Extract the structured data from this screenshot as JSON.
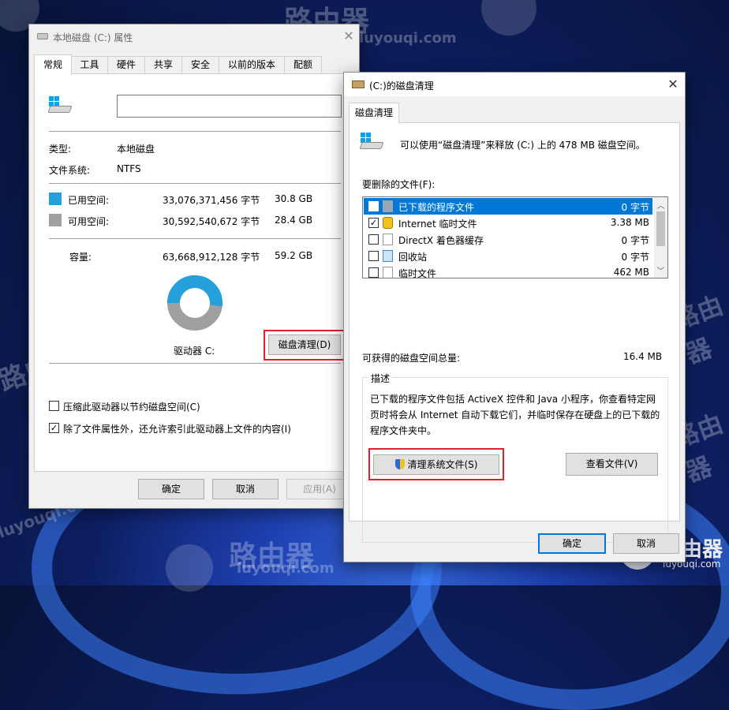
{
  "watermark": {
    "brand_cn": "路由器",
    "brand_url": "luyouqi.com"
  },
  "properties_window": {
    "title": "本地磁盘 (C:) 属性",
    "tabs": [
      "常规",
      "工具",
      "硬件",
      "共享",
      "安全",
      "以前的版本",
      "配额"
    ],
    "volume_label_value": "",
    "type_label": "类型:",
    "type_value": "本地磁盘",
    "fs_label": "文件系统:",
    "fs_value": "NTFS",
    "used_label": "已用空间:",
    "used_bytes": "33,076,371,456 字节",
    "used_size": "30.8 GB",
    "free_label": "可用空间:",
    "free_bytes": "30,592,540,672 字节",
    "free_size": "28.4 GB",
    "capacity_label": "容量:",
    "capacity_bytes": "63,668,912,128 字节",
    "capacity_size": "59.2 GB",
    "drive_label": "驱动器 C:",
    "cleanup_button": "磁盘清理(D)",
    "compress_checkbox": "压缩此驱动器以节约磁盘空间(C)",
    "compress_checked": false,
    "index_checkbox": "除了文件属性外，还允许索引此驱动器上文件的内容(I)",
    "index_checked": true,
    "ok_button": "确定",
    "cancel_button": "取消",
    "apply_button": "应用(A)",
    "colors": {
      "used": "#26a0da",
      "free": "#a0a0a0"
    },
    "chart_used_fraction": 0.52
  },
  "cleanup_window": {
    "title": "(C:)的磁盘清理",
    "tab": "磁盘清理",
    "intro": "可以使用“磁盘清理”来释放  (C:) 上的 478 MB 磁盘空间。",
    "files_label": "要删除的文件(F):",
    "files": [
      {
        "name": "已下载的程序文件",
        "size": "0 字节",
        "checked": true,
        "selected": true,
        "icon": "folder-icon"
      },
      {
        "name": "Internet 临时文件",
        "size": "3.38 MB",
        "checked": true,
        "selected": false,
        "icon": "lock-icon"
      },
      {
        "name": "DirectX 着色器缓存",
        "size": "0 字节",
        "checked": false,
        "selected": false,
        "icon": "file-icon"
      },
      {
        "name": "回收站",
        "size": "0 字节",
        "checked": false,
        "selected": false,
        "icon": "recycle-bin-icon"
      },
      {
        "name": "临时文件",
        "size": "462 MB",
        "checked": false,
        "selected": false,
        "icon": "file-icon"
      }
    ],
    "total_label": "可获得的磁盘空间总量:",
    "total_value": "16.4 MB",
    "description_header": "描述",
    "description_text": "已下载的程序文件包括 ActiveX 控件和 Java 小程序，你查看特定网页时将会从 Internet 自动下载它们，并临时保存在硬盘上的已下载的程序文件夹中。",
    "clean_system_button": "清理系统文件(S)",
    "view_files_button": "查看文件(V)",
    "ok_button": "确定",
    "cancel_button": "取消"
  }
}
